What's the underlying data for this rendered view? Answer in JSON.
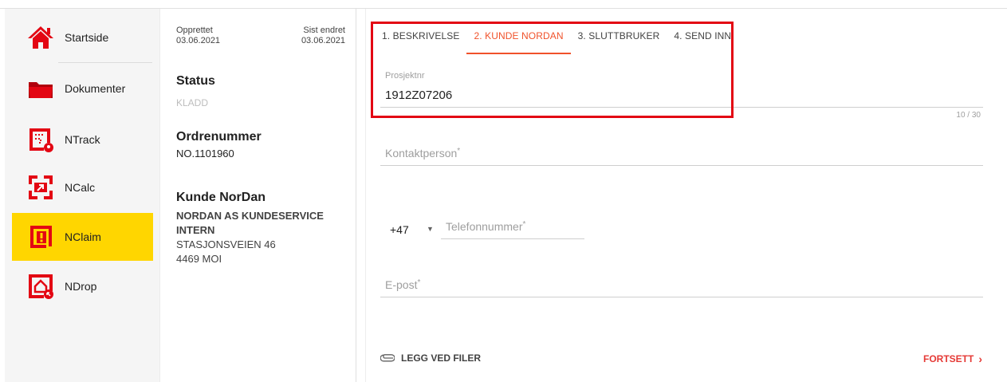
{
  "sidebar": {
    "items": [
      {
        "label": "Startside",
        "icon": "home-icon"
      },
      {
        "label": "Dokumenter",
        "icon": "folder-icon"
      },
      {
        "label": "NTrack",
        "icon": "ntrack-icon"
      },
      {
        "label": "NCalc",
        "icon": "ncalc-icon"
      },
      {
        "label": "NClaim",
        "icon": "nclaim-icon",
        "active": true
      },
      {
        "label": "NDrop",
        "icon": "ndrop-icon"
      }
    ],
    "active_color": "#ffd600",
    "icon_color": "#e30613"
  },
  "info": {
    "created_label": "Opprettet",
    "created_date": "03.06.2021",
    "changed_label": "Sist endret",
    "changed_date": "03.06.2021",
    "status_heading": "Status",
    "status_value": "KLADD",
    "order_heading": "Ordrenummer",
    "order_value": "NO.1101960",
    "customer_heading": "Kunde NorDan",
    "customer_name": "NORDAN AS KUNDESERVICE INTERN",
    "customer_street": "STASJONSVEIEN 46",
    "customer_city": "4469 MOI"
  },
  "tabs": [
    {
      "label": "1. BESKRIVELSE"
    },
    {
      "label": "2. KUNDE NORDAN",
      "active": true
    },
    {
      "label": "3. SLUTTBRUKER"
    },
    {
      "label": "4. SEND INN"
    }
  ],
  "form": {
    "project_label": "Prosjektnr",
    "project_value": "1912Z07206",
    "project_counter": "10 / 30",
    "contact_placeholder": "Kontaktperson",
    "phone_prefix": "+47",
    "phone_placeholder": "Telefonnummer",
    "email_placeholder": "E-post",
    "required_mark": "*"
  },
  "footer": {
    "attach_label": "LEGG VED FILER",
    "next_label": "FORTSETT",
    "next_chevron": "›"
  },
  "colors": {
    "accent": "#f0522b",
    "highlight_box": "#e30613",
    "next_button": "#e53935"
  }
}
